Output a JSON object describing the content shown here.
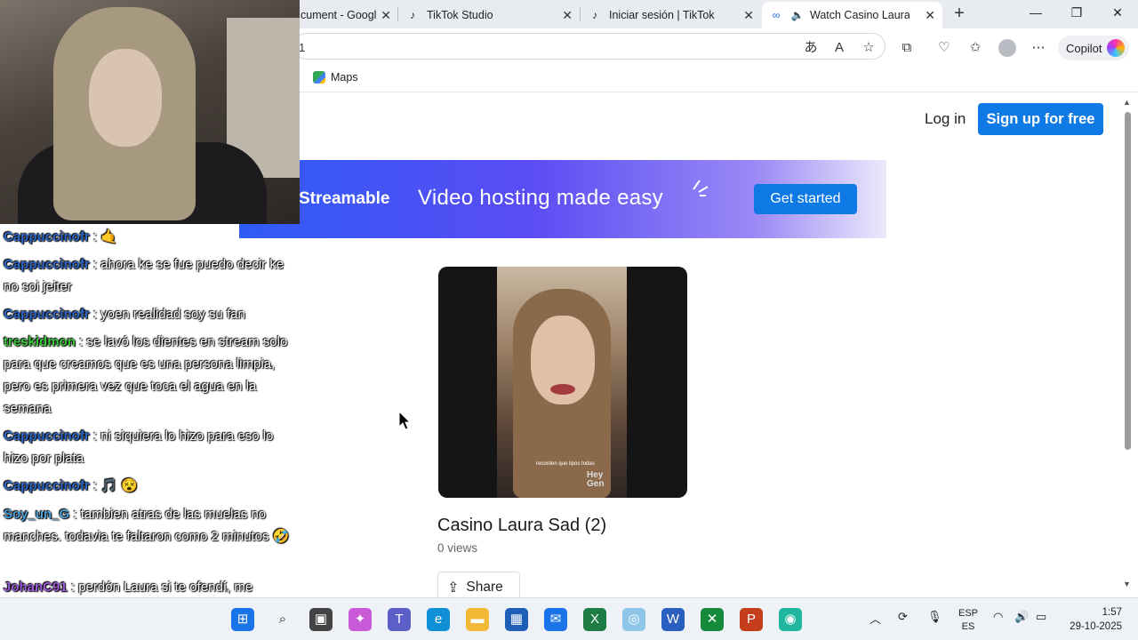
{
  "browser": {
    "tabs": [
      {
        "title": "cument - Googl",
        "favicon": "docs-icon"
      },
      {
        "title": "TikTok Studio",
        "favicon": "tiktok-icon"
      },
      {
        "title": "Iniciar sesión | TikTok",
        "favicon": "tiktok-icon"
      },
      {
        "title": "Watch Casino Laura S",
        "favicon": "streamable-icon",
        "active": true
      }
    ],
    "address_partial": "1",
    "copilot_label": "Copilot",
    "bookmark": "Maps"
  },
  "page": {
    "login": "Log in",
    "signup": "Sign up for free",
    "banner": {
      "brand": "Streamable",
      "tagline": "Video hosting made easy",
      "cta": "Get started"
    },
    "video": {
      "title": "Casino Laura Sad (2)",
      "views": "0 views",
      "share": "Share",
      "subtitle_text": "recorden que lipos todas",
      "watermark": "Hey Gen"
    }
  },
  "chat": [
    {
      "user": "Cappuccinofr",
      "text": " : 🤙",
      "color": "#2e69c9"
    },
    {
      "user": "Cappuccinofr",
      "text": " : ahora ke se fue puedo decir ke no soi jeiter",
      "color": "#2e69c9"
    },
    {
      "user": "Cappuccinofr",
      "text": " : yoen realidad soy su fan",
      "color": "#2e69c9"
    },
    {
      "user": "treskidmon",
      "text": " : se lavó los dientes en stream solo para que creamos que es una persona limpia, pero es primera vez que toca el agua en la semana",
      "color": "#3dc93d"
    },
    {
      "user": "Cappuccinofr",
      "text": " : ni siquiera lo hizo para eso lo hizo por plata",
      "color": "#2e69c9"
    },
    {
      "user": "Cappuccinofr",
      "text": " : 🎵 😵",
      "color": "#2e69c9"
    },
    {
      "user": "Soy_un_G",
      "text": " : tambien atras de las muelas no manches. todavia te faltaron como 2 minutos 🤣",
      "color": "#4aa0d8"
    },
    {
      "user": "JohanC91",
      "text": " : perdón Laura si te ofendí, me siento mal, ahora pienso que no me quieres, estoy triste 😢",
      "color": "#9b59d6"
    }
  ],
  "taskbar": {
    "lang_top": "ESP",
    "lang_bottom": "ES",
    "time": "1:57",
    "date": "29-10-2025"
  }
}
